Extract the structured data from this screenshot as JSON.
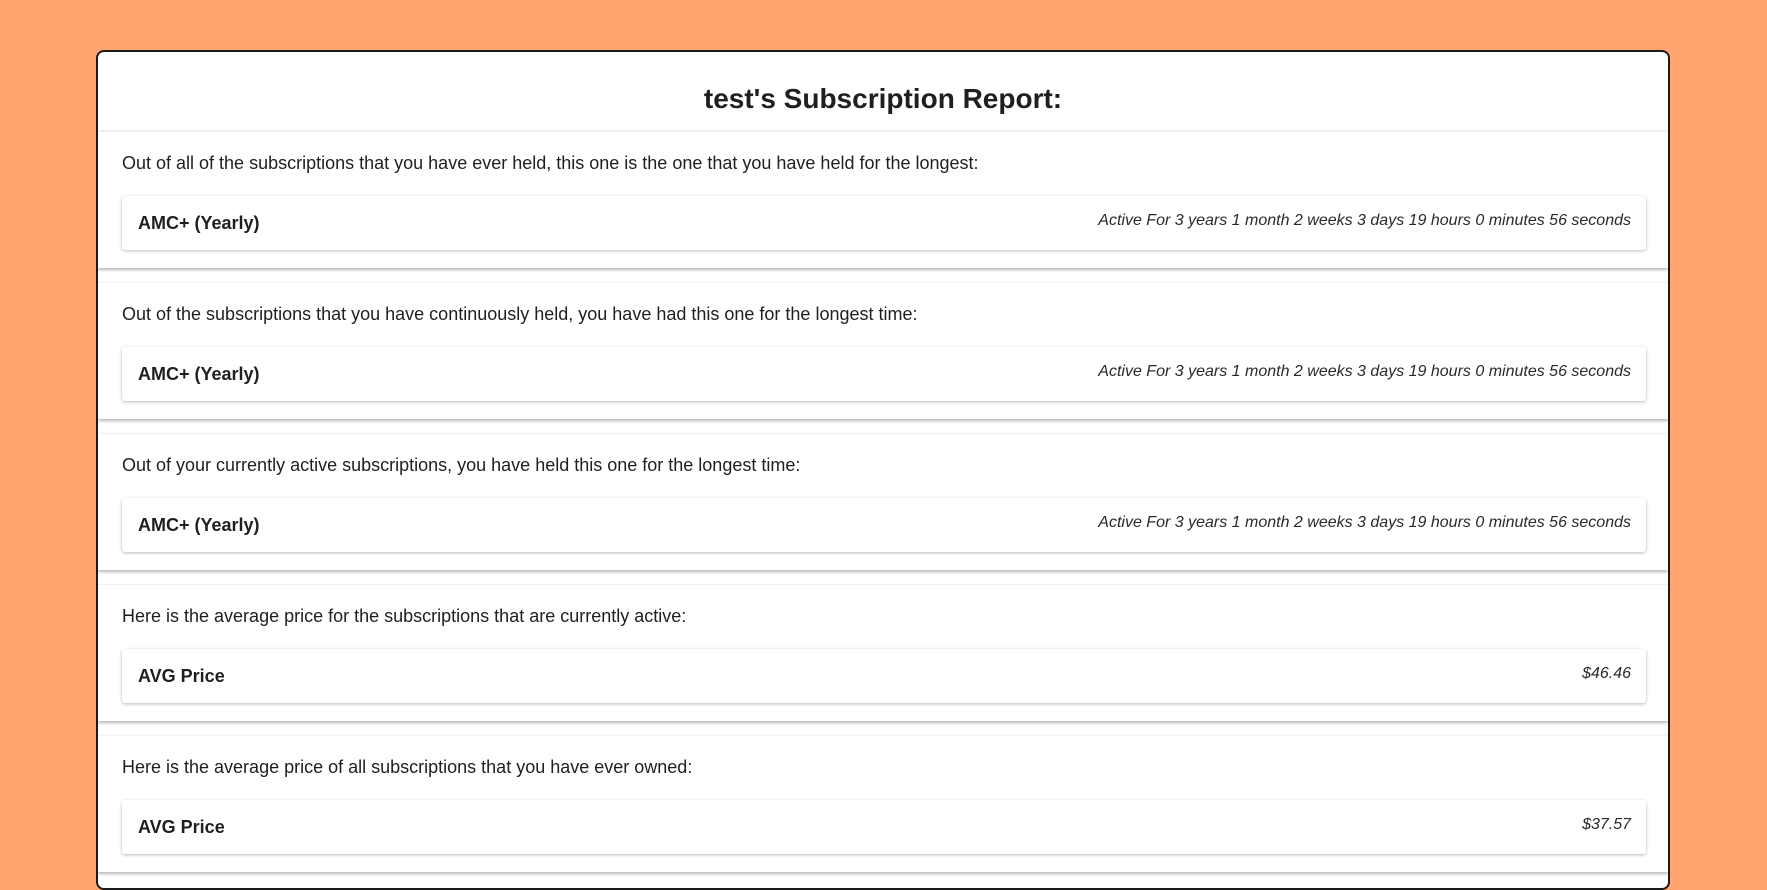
{
  "report": {
    "title": "test's Subscription Report:"
  },
  "sections": [
    {
      "description": "Out of all of the subscriptions that you have ever held, this one is the one that you have held for the longest:",
      "item_name": "AMC+ (Yearly)",
      "item_detail": "Active For 3 years 1 month 2 weeks 3 days 19 hours 0 minutes 56 seconds"
    },
    {
      "description": "Out of the subscriptions that you have continuously held, you have had this one for the longest time:",
      "item_name": "AMC+ (Yearly)",
      "item_detail": "Active For 3 years 1 month 2 weeks 3 days 19 hours 0 minutes 56 seconds"
    },
    {
      "description": "Out of your currently active subscriptions, you have held this one for the longest time:",
      "item_name": "AMC+ (Yearly)",
      "item_detail": "Active For 3 years 1 month 2 weeks 3 days 19 hours 0 minutes 56 seconds"
    },
    {
      "description": "Here is the average price for the subscriptions that are currently active:",
      "item_name": "AVG Price",
      "item_detail": "$46.46"
    },
    {
      "description": "Here is the average price of all subscriptions that you have ever owned:",
      "item_name": "AVG Price",
      "item_detail": "$37.57"
    }
  ],
  "colors": {
    "page_background": "#FFA570",
    "card_background": "#FFFFFF",
    "card_border": "#1A1A1A"
  }
}
